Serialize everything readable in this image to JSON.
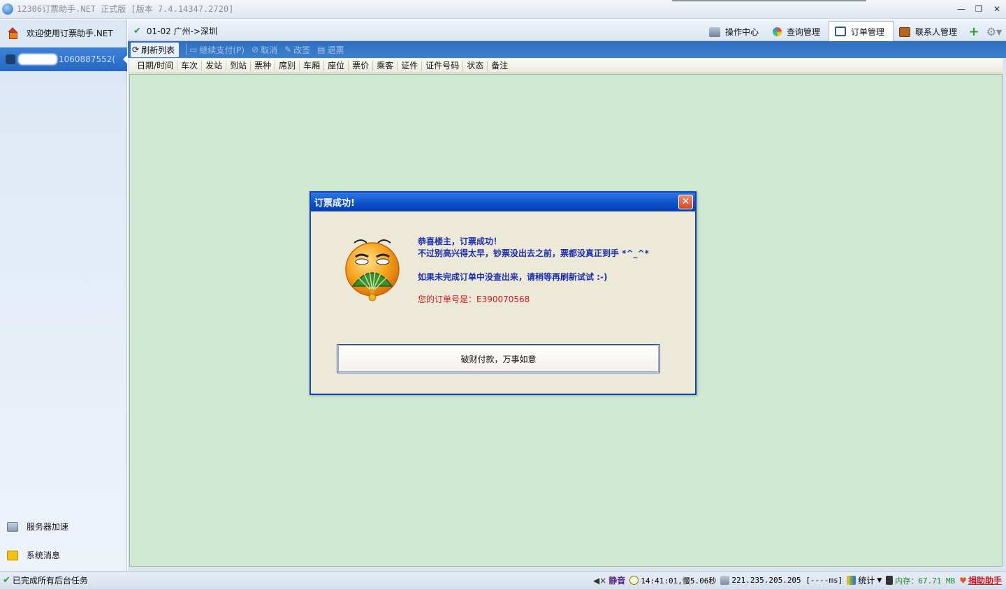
{
  "window": {
    "title": "12306订票助手.NET  正式版 [版本 7.4.14347.2720]",
    "minimize": "—",
    "restore": "❐",
    "close": "✕"
  },
  "sidebar": {
    "welcome": "欢迎使用订票助手.NET",
    "account_suffix": "1060887552(",
    "bottom_items": [
      {
        "label": "服务器加速",
        "icon": "server-icon"
      },
      {
        "label": "系统消息",
        "icon": "message-icon"
      }
    ]
  },
  "header": {
    "route": "01-02  广州->深圳",
    "tabs": [
      {
        "label": "操作中心",
        "icon": "monitor-icon"
      },
      {
        "label": "查询管理",
        "icon": "query-icon"
      },
      {
        "label": "订单管理",
        "icon": "order-icon",
        "active": true
      },
      {
        "label": "联系人管理",
        "icon": "contact-icon"
      }
    ]
  },
  "toolbar": {
    "refresh": "刷新列表",
    "continue_pay": "继续支付(P)",
    "cancel": "取消",
    "change": "改签",
    "refund": "退票"
  },
  "table": {
    "columns": [
      "日期/时间",
      "车次",
      "发站",
      "到站",
      "票种",
      "席别",
      "车厢",
      "座位",
      "票价",
      "乘客",
      "证件",
      "证件号码",
      "状态",
      "备注"
    ]
  },
  "dialog": {
    "title": "订票成功!",
    "line1": "恭喜楼主，订票成功！",
    "line2": "不过别高兴得太早，钞票没出去之前，票都没真正到手 *^_^*",
    "line3": "如果未完成订单中没查出来，请稍等再刷新试试 :-)",
    "order_line": "您的订单号是：E390070568",
    "button": "破财付款，万事如意"
  },
  "status": {
    "left": "已完成所有后台任务",
    "mute": "静音",
    "time": "14:41:01,慢5.06秒",
    "server": "221.235.205.205 [----ms]",
    "stats": "统计",
    "memory": "内存：67.71 MB",
    "donate": "捐助助手"
  },
  "colors": {
    "accent": "#2f6fbe",
    "grid_bg": "#cfe8d1",
    "dialog_title": "#0a4fc8",
    "order_red": "#d01a1a",
    "message_blue": "#1d2fb0"
  }
}
